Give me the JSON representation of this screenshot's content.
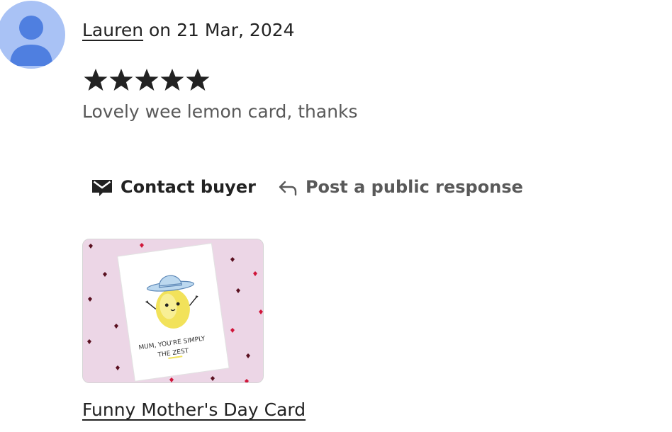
{
  "review": {
    "reviewer_name": "Lauren",
    "date_text": " on 21 Mar, 2024",
    "rating": 5,
    "rating_max": 5,
    "text": "Lovely wee lemon card, thanks"
  },
  "actions": {
    "contact_label": "Contact buyer",
    "contact_icon": "envelope-icon",
    "respond_label": "Post a public response",
    "respond_icon": "reply-arrow-icon"
  },
  "product": {
    "name": "Funny Mother's Day Card",
    "card_text_line1": "MUM, YOU'RE SIMPLY",
    "card_text_line2": "THE ZEST"
  },
  "colors": {
    "avatar_bg": "#a9c2f5",
    "avatar_fg": "#4f7fe0",
    "text_primary": "#222222",
    "text_secondary": "#595959",
    "thumb_bg": "#ecd6e6"
  }
}
